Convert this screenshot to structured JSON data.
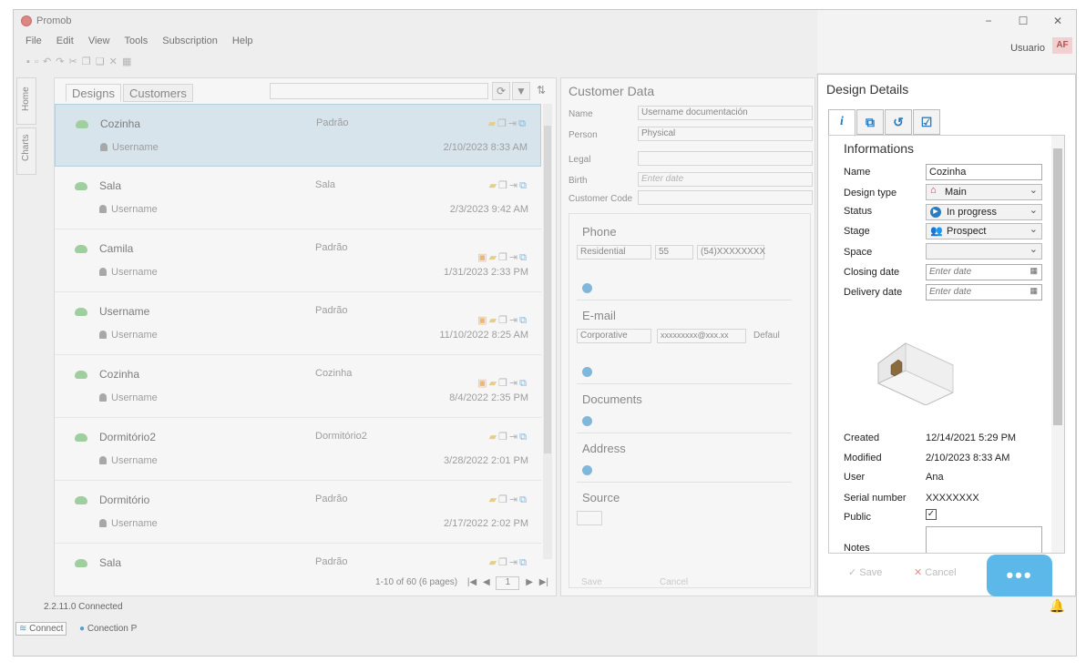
{
  "window": {
    "title": "Promob",
    "minimize": "−",
    "maximize": "☐",
    "close": "✕"
  },
  "menu": [
    "File",
    "Edit",
    "View",
    "Tools",
    "Subscription",
    "Help"
  ],
  "user": {
    "name": "Usuario",
    "initials": "AF"
  },
  "side_tabs": [
    "Home",
    "Charts"
  ],
  "list": {
    "tabs": [
      "Designs",
      "Customers"
    ],
    "rows": [
      {
        "name": "Cozinha",
        "user": "Username",
        "type": "Padrão",
        "date": "2/10/2023 8:33 AM"
      },
      {
        "name": "Sala",
        "user": "Username",
        "type": "Sala",
        "date": "2/3/2023 9:42 AM"
      },
      {
        "name": "Camila",
        "user": "Username",
        "type": "Padrão",
        "date": "1/31/2023 2:33 PM"
      },
      {
        "name": "Username",
        "user": "Username",
        "type": "Padrão",
        "date": "11/10/2022 8:25 AM"
      },
      {
        "name": "Cozinha",
        "user": "Username",
        "type": "Cozinha",
        "date": "8/4/2022 2:35 PM"
      },
      {
        "name": "Dormitório2",
        "user": "Username",
        "type": "Dormitório2",
        "date": "3/28/2022 2:01 PM"
      },
      {
        "name": "Dormitório",
        "user": "Username",
        "type": "Padrão",
        "date": "2/17/2022 2:02 PM"
      },
      {
        "name": "Sala",
        "user": "",
        "type": "Padrão",
        "date": ""
      }
    ],
    "pager": "1-10 of 60 (6 pages)",
    "page": "1"
  },
  "customer": {
    "title": "Customer Data",
    "labels": {
      "name": "Name",
      "person": "Person",
      "legal": "Legal",
      "birth": "Birth",
      "code": "Customer Code"
    },
    "name_value": "Username documentación",
    "person_value": "Physical",
    "birth_placeholder": "Enter date",
    "phone": {
      "title": "Phone",
      "type": "Residential",
      "ddd": "55",
      "number": "(54)XXXXXXXX"
    },
    "email": {
      "title": "E-mail",
      "type": "Corporative",
      "address": "xxxxxxxxx@xxx.xx",
      "default": "Defaul"
    },
    "documents": "Documents",
    "address": "Address",
    "source": "Source",
    "save": "Save",
    "cancel": "Cancel"
  },
  "detail": {
    "title": "Design Details",
    "section": "Informations",
    "labels": {
      "name": "Name",
      "design_type": "Design type",
      "status": "Status",
      "stage": "Stage",
      "space": "Space",
      "closing_date": "Closing date",
      "delivery_date": "Delivery date",
      "created": "Created",
      "modified": "Modified",
      "user": "User",
      "serial": "Serial number",
      "public": "Public",
      "notes": "Notes"
    },
    "values": {
      "name": "Cozinha",
      "design_type": "Main",
      "status": "In progress",
      "stage": "Prospect",
      "space": "",
      "date_placeholder": "Enter date",
      "created": "12/14/2021 5:29 PM",
      "modified": "2/10/2023 8:33 AM",
      "user": "Ana",
      "serial": "XXXXXXXX",
      "public_checked": "✓"
    },
    "save": "Save",
    "cancel": "Cancel",
    "chat": "•••"
  },
  "status": {
    "version": "2.2.11.0 Connected",
    "connect": "Connect",
    "connection": "Conection P"
  }
}
